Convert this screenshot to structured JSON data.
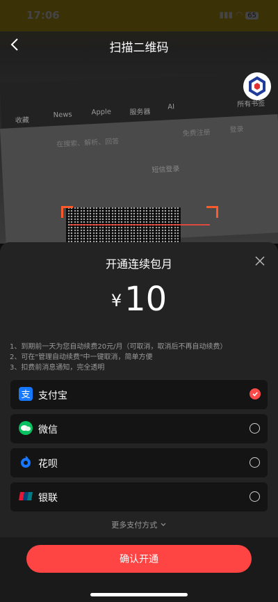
{
  "status_bar": {
    "time": "17:06",
    "battery": "65"
  },
  "nav": {
    "title": "扫描二维码"
  },
  "camera": {
    "bookmarks": [
      "收藏",
      "News",
      "Apple",
      "服务器",
      "AI",
      "所有书签"
    ],
    "page_text": [
      "在搜索、解析、回答",
      "免费注册",
      "登录",
      "短信登录"
    ]
  },
  "sheet": {
    "title": "开通连续包月",
    "currency": "¥",
    "amount": "10",
    "notes": [
      "1、到期前一天为您自动续费20元/月（可取消，取消后不再自动续费）",
      "2、可在\"管理自动续费\"中一键取消，简单方便",
      "3、扣费前消息通知，完全透明"
    ],
    "payment_methods": [
      {
        "label": "支付宝",
        "icon": "alipay-icon",
        "selected": true,
        "color": "#1677ff"
      },
      {
        "label": "微信",
        "icon": "wechat-icon",
        "selected": false,
        "color": "#07c160"
      },
      {
        "label": "花呗",
        "icon": "huabei-icon",
        "selected": false,
        "color": "#1677ff"
      },
      {
        "label": "银联",
        "icon": "unionpay-icon",
        "selected": false,
        "color": "#e21836"
      }
    ],
    "more_payment": "更多支付方式",
    "confirm": "确认开通"
  },
  "colors": {
    "accent": "#ff4444",
    "sheet_bg": "#232323",
    "item_bg": "#141414"
  }
}
